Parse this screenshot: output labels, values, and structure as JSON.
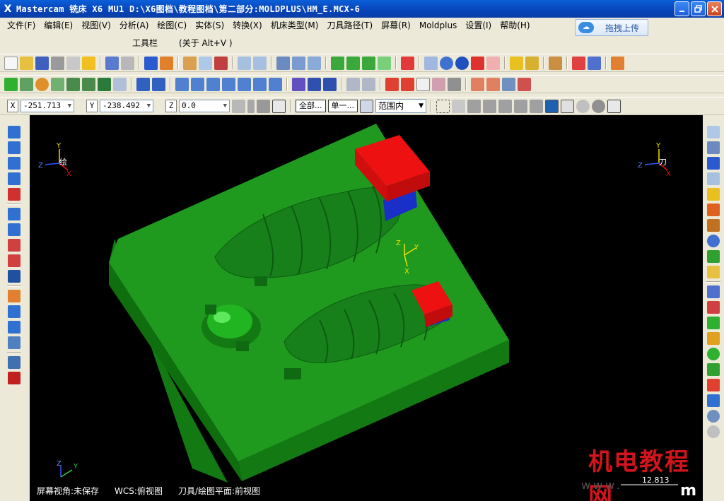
{
  "window": {
    "title": "Mastercam 铣床 X6 MU1  D:\\X6图档\\教程图档\\第二部分:MOLDPLUS\\HM_E.MCX-6",
    "app_icon": "X"
  },
  "menu": [
    "文件(F)",
    "编辑(E)",
    "视图(V)",
    "分析(A)",
    "绘图(C)",
    "实体(S)",
    "转换(X)",
    "机床类型(M)",
    "刀具路径(T)",
    "屏幕(R)",
    "Moldplus",
    "设置(I)",
    "帮助(H)"
  ],
  "upload_button": "拖拽上传",
  "tools_row": {
    "toolbar_label": "工具栏",
    "about_label": "(关于 Alt+V )"
  },
  "coords": {
    "x_label": "X",
    "x_value": "-251.713",
    "y_label": "Y",
    "y_value": "-238.492",
    "z_label": "Z",
    "z_value": "0.0"
  },
  "selection": {
    "all_label": "全部...",
    "single_label": "单一...",
    "mode_value": "范围内"
  },
  "viewport": {
    "left_gnomon": {
      "y": "Y",
      "z": "Z",
      "x": "X",
      "label": "绘"
    },
    "right_gnomon": {
      "y": "Y",
      "z": "Z",
      "x": "X",
      "label": "刀"
    },
    "center_gnomon": {
      "z": "Z",
      "y": "Y",
      "x": "X"
    },
    "bottom_gnomon": {
      "z": "Z",
      "y": "Y"
    },
    "status": {
      "screen_view": "屏幕视角:未保存",
      "wcs": "WCS:俯视图",
      "tool_plane": "刀具/绘图平面:前视图"
    },
    "scale_value": "12.813",
    "watermark": "机电教程网",
    "www": "www.",
    "m_logo": "m"
  },
  "colors": {
    "base_green": "#1f9a1f",
    "base_side": "#137a13",
    "part_green": "#17801b",
    "box_red": "#ee1111",
    "box_blue": "#1a2ec8",
    "axis_yellow": "#f0e000",
    "axis_red": "#e01010",
    "axis_blue": "#3355ff",
    "axis_green": "#30d030"
  }
}
